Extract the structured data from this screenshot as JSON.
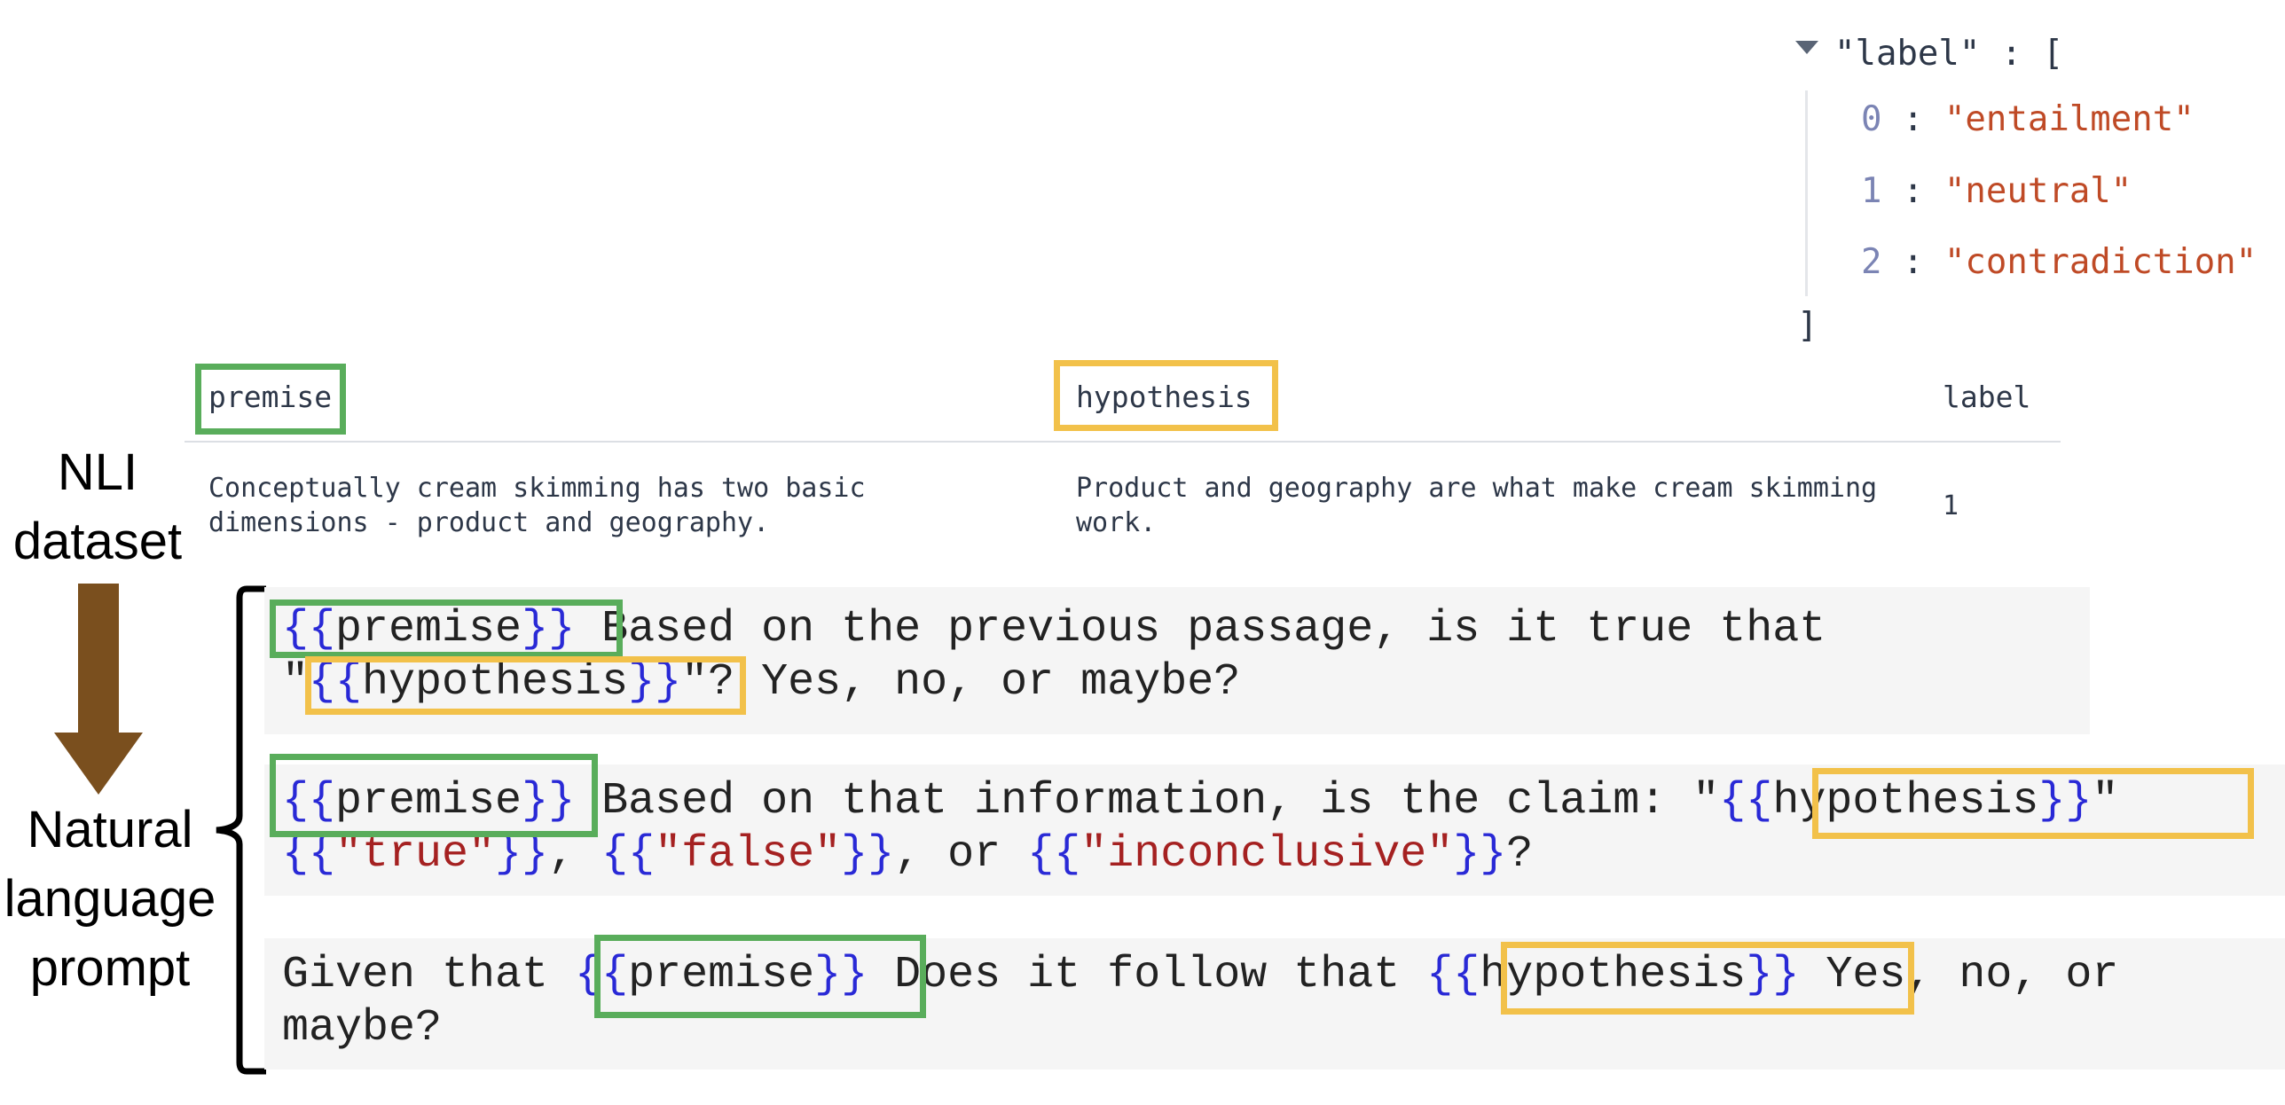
{
  "json_view": {
    "key": "\"label\"",
    "open": "[",
    "close": "]",
    "separator": ":",
    "items": [
      {
        "index": "0",
        "value": "\"entailment\""
      },
      {
        "index": "1",
        "value": "\"neutral\""
      },
      {
        "index": "2",
        "value": "\"contradiction\""
      }
    ]
  },
  "table": {
    "headers": {
      "premise": "premise",
      "hypothesis": "hypothesis",
      "label": "label"
    },
    "row": {
      "premise_line1": "Conceptually cream skimming has two basic",
      "premise_line2": "dimensions - product and geography.",
      "hypothesis_line1": "Product and geography are what make cream skimming",
      "hypothesis_line2": "work.",
      "label": "1"
    }
  },
  "side_labels": {
    "dataset_line1": "NLI",
    "dataset_line2": "dataset",
    "prompt_line1": "Natural",
    "prompt_line2": "language",
    "prompt_line3": "prompt"
  },
  "templates": {
    "open_brace": "{{",
    "close_brace": "}}",
    "premise_var": "premise",
    "hypothesis_var": "hypothesis",
    "t1_mid": " Based on the previous passage, is it true that",
    "t1_quote_open": "\"",
    "t1_end": "\"? Yes, no, or maybe?",
    "t2_mid": " Based on that information, is the claim: \"",
    "t2_quote_close": "\"",
    "t2_true": "\"true\"",
    "t2_false": "\"false\"",
    "t2_inconclusive": "\"inconclusive\"",
    "t2_sep1": ", ",
    "t2_sep2": ", or ",
    "t2_end": "?",
    "t3_start": "Given that ",
    "t3_mid": " Does it follow that ",
    "t3_end": " Yes, no, or",
    "t3_line2": "maybe?"
  },
  "colors": {
    "premise_box": "#59ad5b",
    "hypothesis_box": "#f2c14a",
    "arrow": "#7a4f1e",
    "template_brace": "#2929d6",
    "template_literal": "#a52121"
  }
}
